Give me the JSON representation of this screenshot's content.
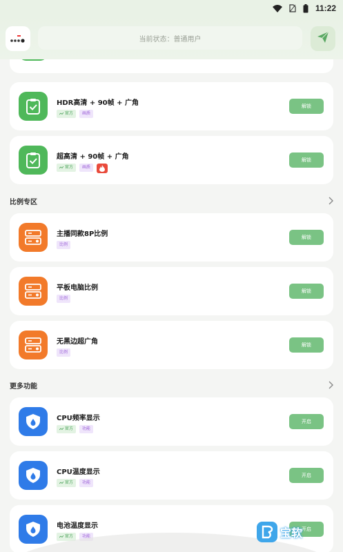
{
  "status_bar": {
    "time": "11:22"
  },
  "header": {
    "search_placeholder": "当前状态：普通用户"
  },
  "tags": {
    "official": "官方",
    "quality": "画质",
    "ratio": "比例",
    "feature": "功能"
  },
  "sections": {
    "ratio": "比例专区",
    "more": "更多功能"
  },
  "cards": [
    {
      "title": "HDR高清 + 90帧 + 广角",
      "button": "解锁"
    },
    {
      "title": "超高清 + 90帧 + 广角",
      "button": "解锁"
    },
    {
      "title": "主播同款8P比例",
      "button": "解锁"
    },
    {
      "title": "平板电脑比例",
      "button": "解锁"
    },
    {
      "title": "无黑边超广角",
      "button": "解锁"
    },
    {
      "title": "CPU频率显示",
      "button": "开启"
    },
    {
      "title": "CPU温度显示",
      "button": "开启"
    },
    {
      "title": "电池温度显示",
      "button": "开启"
    }
  ],
  "watermark": {
    "text": "宝软"
  },
  "colors": {
    "accent_green": "#4fb85a",
    "button_green": "#7ac384",
    "orange": "#f27a2a",
    "blue": "#2f7be8"
  }
}
